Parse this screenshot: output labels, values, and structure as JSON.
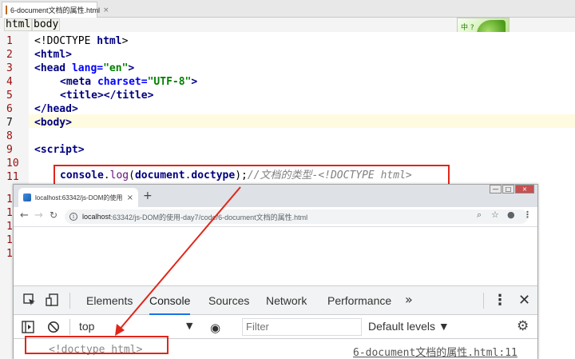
{
  "ide": {
    "file_tab": "6-document文档的属性.html",
    "tab_close": "×",
    "breadcrumb": [
      "html",
      "body"
    ],
    "badge_text": "中 ?",
    "line_numbers": [
      "1",
      "2",
      "3",
      "4",
      "5",
      "6",
      "7",
      "8",
      "9",
      "10",
      "11",
      "1",
      "1",
      "1",
      "1",
      "1"
    ],
    "code": {
      "l1_open": "<!DOCTYPE ",
      "l1_html": "html",
      "l1_close": ">",
      "l2": "<html>",
      "l3_open": "<head ",
      "l3_attr": "lang=",
      "l3_val": "\"en\"",
      "l3_close": ">",
      "l4_open": "<meta ",
      "l4_attr": "charset=",
      "l4_val": "\"UTF-8\"",
      "l4_close": ">",
      "l5": "<title></title>",
      "l6": "</head>",
      "l7": "<body>",
      "l9": "<script>",
      "l11_console": "console",
      "l11_dot": ".",
      "l11_log": "log",
      "l11_paren": "(",
      "l11_doc": "document",
      "l11_doctype": "doctype",
      "l11_end": ");",
      "l11_comment": "//文档的类型-<!DOCTYPE html>"
    }
  },
  "browser": {
    "tab_title": "localhost:63342/js-DOM的使用",
    "tab_close": "×",
    "new_tab": "+",
    "url_host": "localhost",
    "url_path": ":63342/js-DOM的使用-day7/code/6-document文档的属性.html",
    "win_min": "—",
    "win_max": "□",
    "win_close": "×"
  },
  "devtools": {
    "tabs": [
      "Elements",
      "Console",
      "Sources",
      "Network",
      "Performance"
    ],
    "active_tab": "Console",
    "more": "»",
    "context": "top",
    "filter_placeholder": "Filter",
    "levels": "Default levels ▼",
    "output_value": "<!doctype html>",
    "output_source": "6-document文档的属性.html:11"
  },
  "colors": {
    "annotation_red": "#e0261a",
    "tag_navy": "#000080",
    "string_green": "#008000",
    "accent_blue": "#1a73e8"
  }
}
